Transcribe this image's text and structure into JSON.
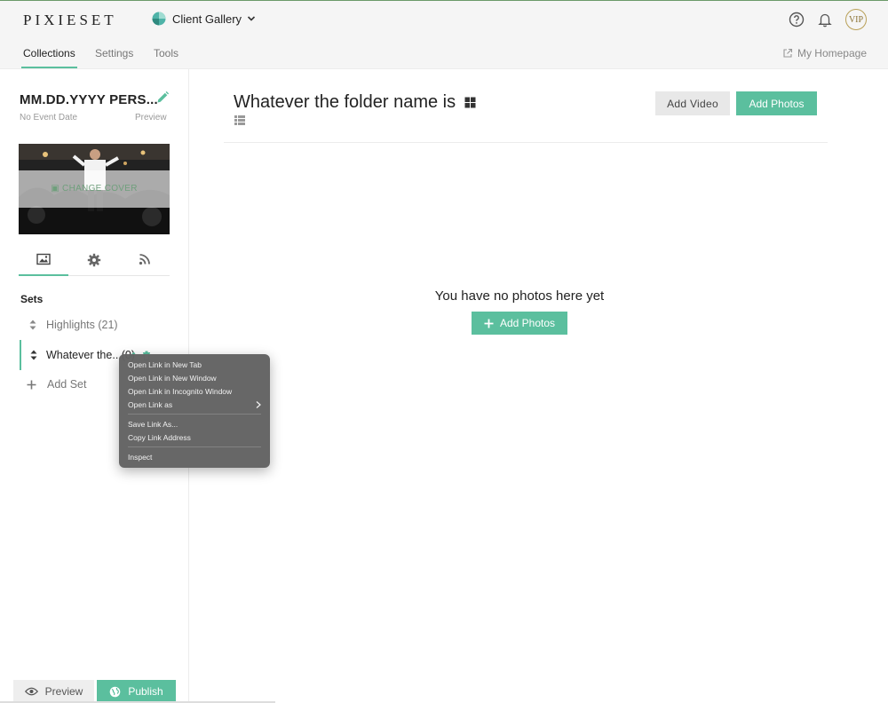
{
  "header": {
    "logo": "PIXIESET",
    "gallery_switcher": "Client Gallery",
    "vip_badge": "VIP",
    "icons": [
      "help-icon",
      "bell-icon",
      "vip-avatar"
    ]
  },
  "nav": {
    "tabs": [
      {
        "label": "Collections",
        "active": true
      },
      {
        "label": "Settings",
        "active": false
      },
      {
        "label": "Tools",
        "active": false
      }
    ],
    "homepage_link": "My Homepage"
  },
  "sidebar": {
    "collection_title": "MM.DD.YYYY PERS...",
    "event_date": "No Event Date",
    "preview_link": "Preview",
    "cover_action": "CHANGE COVER",
    "side_tab_icons": [
      "image-icon",
      "gear-icon",
      "rss-icon"
    ],
    "sets_label": "Sets",
    "sets": [
      {
        "label": "Highlights (21)",
        "active": false
      },
      {
        "label": "Whatever the...(0)",
        "active": true
      }
    ],
    "add_set": "Add Set",
    "preview_button": "Preview",
    "publish_button": "Publish"
  },
  "main": {
    "folder_title": "Whatever the folder name is",
    "add_video_button": "Add Video",
    "add_photos_button": "Add Photos",
    "empty_message": "You have no photos here yet",
    "empty_add_photos_button": "Add Photos"
  },
  "context_menu": {
    "group1": [
      "Open Link in New Tab",
      "Open Link in New Window",
      "Open Link in Incognito Window",
      "Open Link as"
    ],
    "group2": [
      "Save Link As...",
      "Copy Link Address"
    ],
    "group3": [
      "Inspect"
    ]
  },
  "colors": {
    "accent": "#5bbf9e",
    "topbar_bg": "#f5f5f5",
    "menu_bg": "#626262"
  }
}
